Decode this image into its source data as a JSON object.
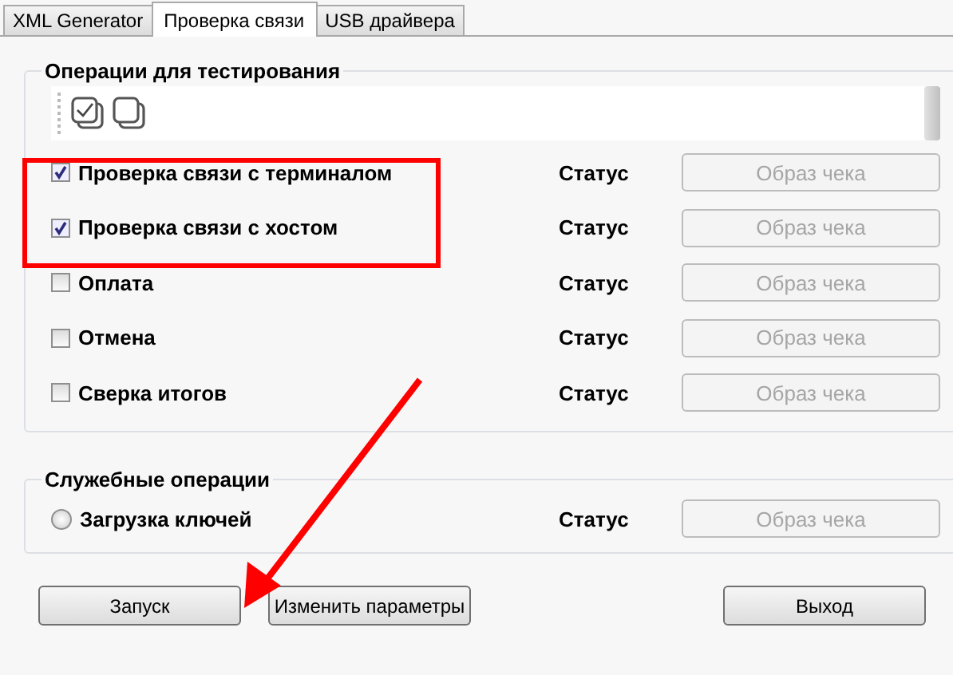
{
  "tabs": [
    {
      "label": "XML Generator",
      "selected": false
    },
    {
      "label": "Проверка связи",
      "selected": true
    },
    {
      "label": "USB драйвера",
      "selected": false
    }
  ],
  "test_operations": {
    "title": "Операции для тестирования",
    "rows": [
      {
        "label": "Проверка связи с терминалом",
        "checked": true,
        "status": "Статус",
        "receipt_button": {
          "label": "Образ чека",
          "disabled": true
        }
      },
      {
        "label": "Проверка связи с хостом",
        "checked": true,
        "status": "Статус",
        "receipt_button": {
          "label": "Образ чека",
          "disabled": true
        }
      },
      {
        "label": "Оплата",
        "checked": false,
        "status": "Статус",
        "receipt_button": {
          "label": "Образ чека",
          "disabled": true
        }
      },
      {
        "label": "Отмена",
        "checked": false,
        "status": "Статус",
        "receipt_button": {
          "label": "Образ чека",
          "disabled": true
        }
      },
      {
        "label": "Сверка итогов",
        "checked": false,
        "status": "Статус",
        "receipt_button": {
          "label": "Образ чека",
          "disabled": true
        }
      }
    ]
  },
  "service_operations": {
    "title": "Служебные операции",
    "rows": [
      {
        "label": "Загрузка ключей",
        "selected": false,
        "status": "Статус",
        "receipt_button": {
          "label": "Образ чека",
          "disabled": true
        }
      }
    ]
  },
  "buttons": [
    {
      "label": "Запуск"
    },
    {
      "label": "Изменить параметры"
    },
    {
      "label": "Выход"
    }
  ]
}
